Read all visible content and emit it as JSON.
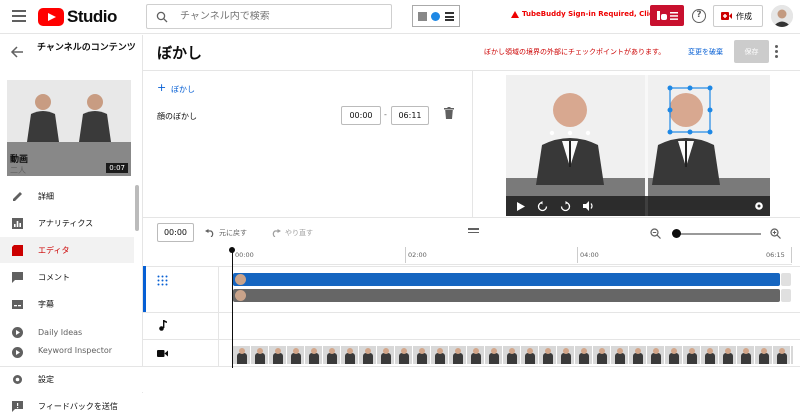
{
  "topbar": {
    "logo_text": "Studio",
    "search_placeholder": "チャンネル内で検索",
    "warning": "TubeBuddy Sign-in Required, Click Here",
    "create_label": "作成",
    "help_glyph": "?"
  },
  "sidebar": {
    "channel_title": "チャンネルのコンテンツ",
    "thumb_duration": "0:07",
    "video_label": "動画",
    "video_sub": "二人",
    "items": [
      {
        "label": "詳細",
        "icon": "pencil-icon"
      },
      {
        "label": "アナリティクス",
        "icon": "analytics-icon"
      },
      {
        "label": "エディタ",
        "icon": "editor-icon",
        "active": true
      },
      {
        "label": "コメント",
        "icon": "comment-icon"
      },
      {
        "label": "字幕",
        "icon": "subtitles-icon"
      },
      {
        "label": "Daily Ideas",
        "icon": "play-circle-icon"
      },
      {
        "label": "Keyword Inspector",
        "icon": "play-circle-icon"
      }
    ],
    "settings": "設定",
    "feedback": "フィードバックを送信"
  },
  "editor": {
    "title": "ぼかし",
    "notice": "ぼかし領域の境界の外部にチェックポイントがあります。",
    "discard": "変更を破棄",
    "save": "保存",
    "add_blur": "ぼかし",
    "blur_name": "顔のぼかし",
    "start_time": "00:00",
    "dash": "-",
    "end_time": "06:11"
  },
  "timeline": {
    "current_time": "00:00",
    "undo": "元に戻す",
    "redo": "やり直す",
    "ticks": [
      "00:00",
      "02:00",
      "04:00",
      "06:15"
    ],
    "zoom_level": 0.0
  },
  "colors": {
    "accent_blue": "#065fd4",
    "track_blue": "#1565c0",
    "track_gray": "#666666",
    "active_red": "#cc0000"
  }
}
